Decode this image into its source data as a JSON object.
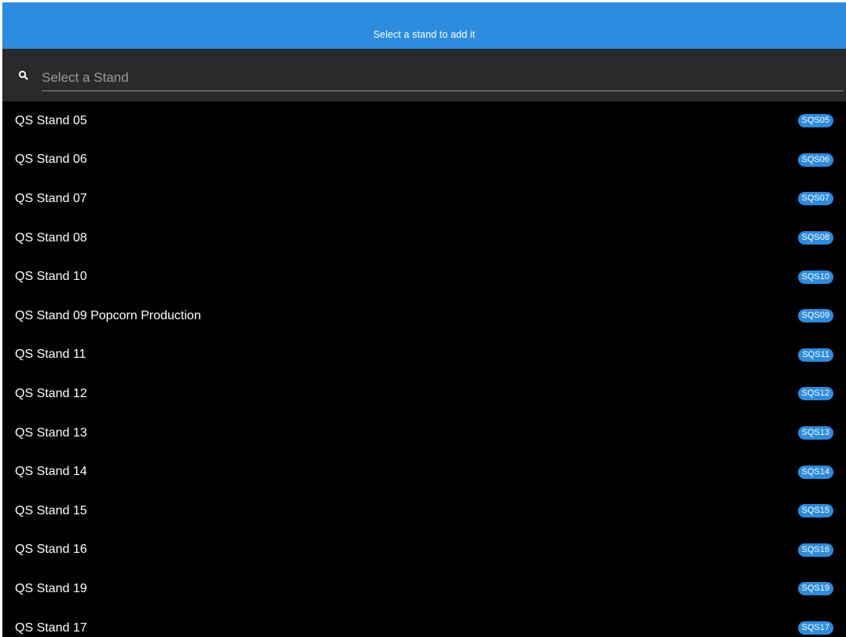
{
  "header": {
    "title": "Select a stand to add it"
  },
  "search": {
    "placeholder": "Select a Stand",
    "value": "",
    "icon": "search-icon"
  },
  "colors": {
    "accent": "#2b8ce0",
    "background": "#000000",
    "search_bar": "#2a2a2c"
  },
  "stands": [
    {
      "label": "QS Stand 05",
      "code": "SQS05"
    },
    {
      "label": "QS Stand 06",
      "code": "SQS06"
    },
    {
      "label": "QS Stand 07",
      "code": "SQS07"
    },
    {
      "label": "QS Stand 08",
      "code": "SQS08"
    },
    {
      "label": "QS Stand 10",
      "code": "SQS10"
    },
    {
      "label": "QS Stand 09 Popcorn Production",
      "code": "SQS09"
    },
    {
      "label": "QS Stand 11",
      "code": "SQS11"
    },
    {
      "label": "QS Stand 12",
      "code": "SQS12"
    },
    {
      "label": "QS Stand 13",
      "code": "SQS13"
    },
    {
      "label": "QS Stand 14",
      "code": "SQS14"
    },
    {
      "label": "QS Stand 15",
      "code": "SQS15"
    },
    {
      "label": "QS Stand 16",
      "code": "SQS16"
    },
    {
      "label": "QS Stand 19",
      "code": "SQS19"
    },
    {
      "label": "QS Stand 17",
      "code": "SQS17"
    }
  ]
}
